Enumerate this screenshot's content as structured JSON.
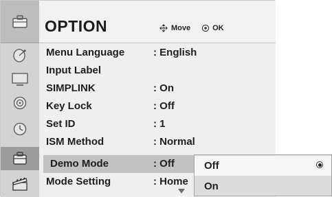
{
  "menu": {
    "title": "OPTION",
    "hints": {
      "move": "Move",
      "ok": "OK"
    },
    "rows": [
      {
        "label": "Menu Language",
        "value": ": English"
      },
      {
        "label": "Input Label",
        "value": ""
      },
      {
        "label": "SIMPLINK",
        "value": ": On"
      },
      {
        "label": "Key Lock",
        "value": ": Off"
      },
      {
        "label": "Set ID",
        "value": ": 1"
      },
      {
        "label": "ISM Method",
        "value": ": Normal"
      },
      {
        "label": "Demo Mode",
        "value": ": Off"
      },
      {
        "label": "Mode Setting",
        "value": ": Home"
      }
    ]
  },
  "sidebar": {
    "icons": [
      "option-toolbox-icon",
      "satellite-dish-icon",
      "monitor-icon",
      "speaker-icon",
      "clock-icon",
      "lock-box-icon",
      "clapperboard-icon"
    ],
    "active_icon": "lock-box-icon"
  },
  "popup": {
    "options": [
      {
        "label": "Off",
        "selected": true
      },
      {
        "label": "On",
        "selected": false
      }
    ]
  },
  "colors": {
    "selected_row": "#c2c2c2",
    "active_rail": "#9d9d9d"
  }
}
